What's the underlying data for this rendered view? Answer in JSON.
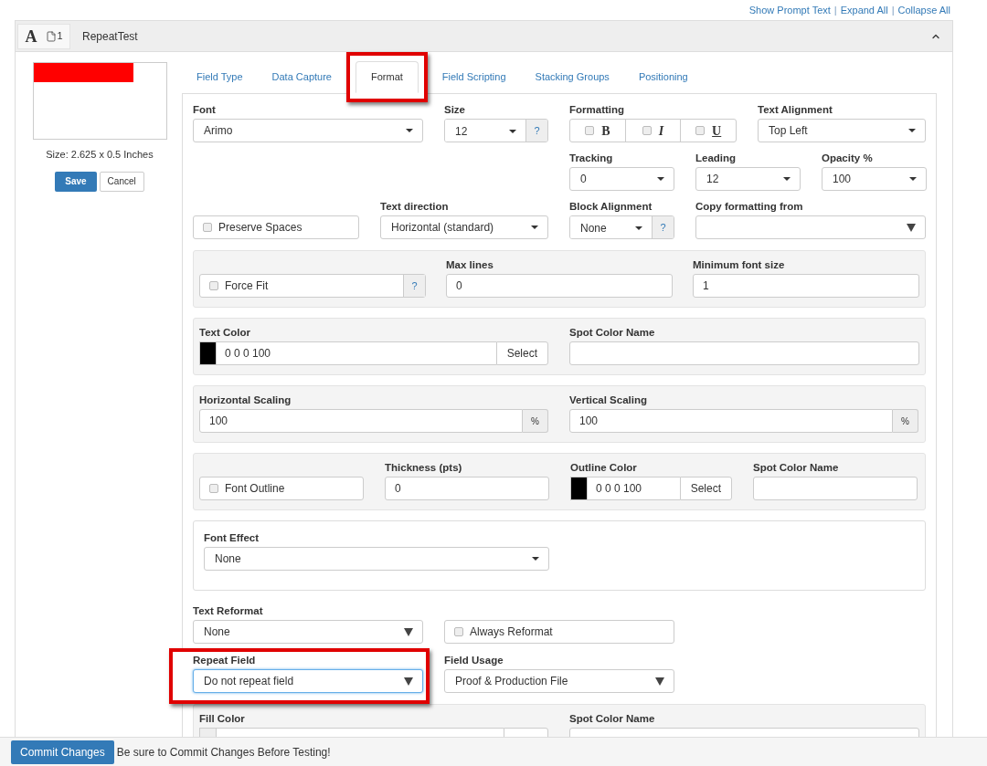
{
  "top_links": [
    {
      "kind": "link",
      "text": "Show Prompt Text"
    },
    {
      "kind": "separator",
      "text": "|"
    },
    {
      "kind": "link",
      "text": "Expand All"
    },
    {
      "kind": "separator",
      "text": "|"
    },
    {
      "kind": "link",
      "text": "Collapse All"
    }
  ],
  "header": {
    "type_letter": "A",
    "page_count": "1",
    "title": "RepeatTest",
    "expanded": true
  },
  "preview": {
    "color": "#ff0000",
    "size_text": "Size: 2.625 x 0.5 Inches",
    "save": "Save",
    "cancel": "Cancel"
  },
  "tabs": [
    {
      "label": "Field Type",
      "selected": false,
      "highlighted": false
    },
    {
      "label": "Data Capture",
      "selected": false,
      "highlighted": false
    },
    {
      "label": "Format",
      "selected": true,
      "highlighted": true
    },
    {
      "label": "Field Scripting",
      "selected": false,
      "highlighted": false
    },
    {
      "label": "Stacking Groups",
      "selected": false,
      "highlighted": false
    },
    {
      "label": "Positioning",
      "selected": false,
      "highlighted": false
    }
  ],
  "format": {
    "font": {
      "label": "Font",
      "value": "Arimo"
    },
    "size": {
      "label": "Size",
      "value": "12",
      "help": "?"
    },
    "formatting": {
      "label": "Formatting",
      "options": [
        {
          "kind": "bold",
          "text": "B",
          "checked": false
        },
        {
          "kind": "italic",
          "text": "I",
          "checked": false
        },
        {
          "kind": "underline",
          "text": "U",
          "checked": false
        }
      ]
    },
    "text_alignment": {
      "label": "Text Alignment",
      "value": "Top Left"
    },
    "tracking": {
      "label": "Tracking",
      "value": "0"
    },
    "leading": {
      "label": "Leading",
      "value": "12"
    },
    "opacity": {
      "label": "Opacity %",
      "value": "100"
    },
    "preserve_spaces": {
      "label": "Preserve Spaces",
      "checked": false
    },
    "text_direction": {
      "label": "Text direction",
      "value": "Horizontal (standard)"
    },
    "block_alignment": {
      "label": "Block Alignment",
      "value": "None",
      "help": "?"
    },
    "copy_formatting_from": {
      "label": "Copy formatting from"
    },
    "force_fit": {
      "label": "Force Fit",
      "checked": false,
      "help": "?"
    },
    "max_lines": {
      "label": "Max lines",
      "value": "0"
    },
    "minimum_font_size": {
      "label": "Minimum font size",
      "value": "1"
    },
    "text_color": {
      "label": "Text Color",
      "color": "#000000",
      "value": "0 0 0 100",
      "button": "Select"
    },
    "text_spot_color_name": {
      "label": "Spot Color Name"
    },
    "horizontal_scaling": {
      "label": "Horizontal Scaling",
      "value": "100",
      "unit": "%"
    },
    "vertical_scaling": {
      "label": "Vertical Scaling",
      "value": "100",
      "unit": "%"
    },
    "font_outline": {
      "label": "Font Outline",
      "checked": false
    },
    "thickness": {
      "label": "Thickness (pts)",
      "value": "0"
    },
    "outline_color": {
      "label": "Outline Color",
      "color": "#000000",
      "value": "0 0 0 100",
      "button": "Select"
    },
    "outline_spot_color_name": {
      "label": "Spot Color Name"
    },
    "font_effect": {
      "label": "Font Effect",
      "value": "None"
    },
    "text_reformat": {
      "label": "Text Reformat",
      "value": "None"
    },
    "always_reformat": {
      "label": "Always Reformat",
      "checked": false
    },
    "repeat_field": {
      "label": "Repeat Field",
      "value": "Do not repeat field",
      "highlighted": true,
      "focused": true
    },
    "field_usage": {
      "label": "Field Usage",
      "value": "Proof & Production File"
    },
    "fill_color": {
      "label": "Fill Color",
      "color": "#eeeeee"
    },
    "fill_spot_color_name": {
      "label": "Spot Color Name"
    }
  },
  "footer": {
    "commit": "Commit Changes",
    "note": "Be sure to Commit Changes Before Testing!"
  }
}
